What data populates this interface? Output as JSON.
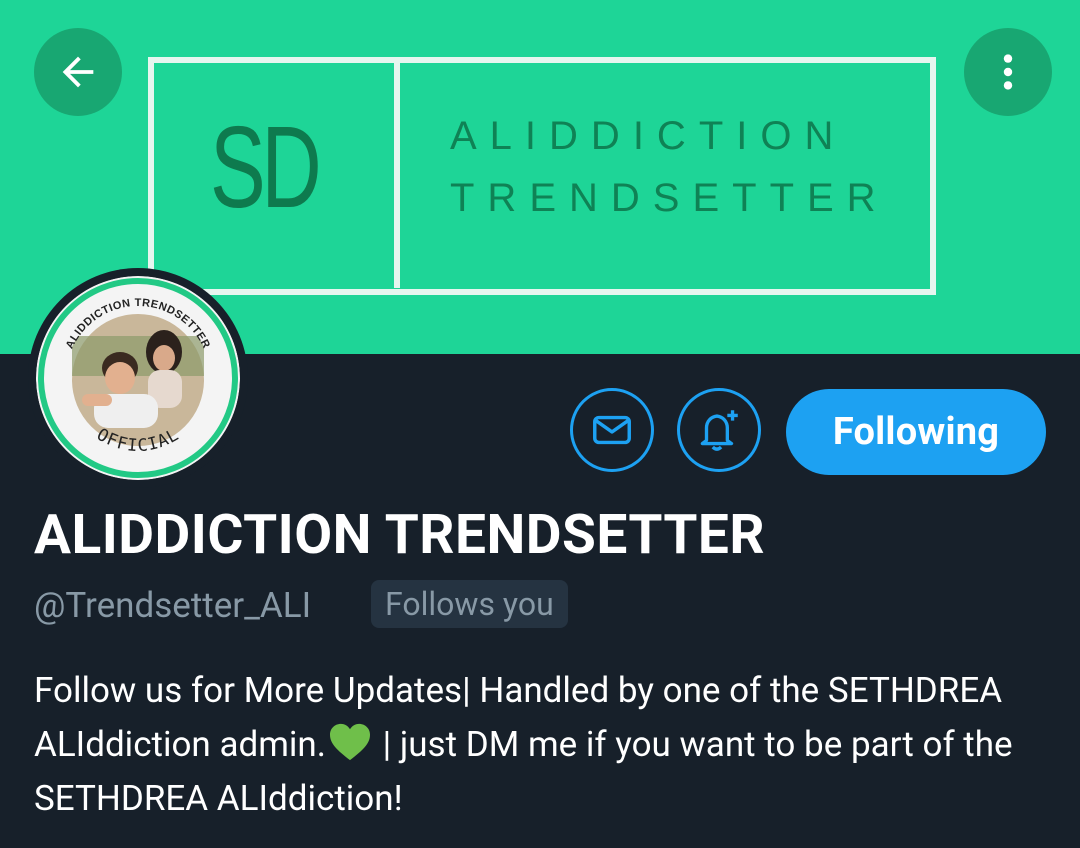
{
  "banner": {
    "logo_initials": "SD",
    "title_line1": "ALIDDICTION",
    "title_line2": "TRENDSETTER",
    "background_color": "#1ed597"
  },
  "header": {
    "back_icon": "arrow-left-icon",
    "more_icon": "more-vertical-icon"
  },
  "avatar": {
    "ring_text": "ALIDDICTION TRENDSETTER",
    "badge_text": "OFFICIAL"
  },
  "actions": {
    "message_icon": "mail-icon",
    "notify_icon": "bell-plus-icon",
    "following_label": "Following",
    "accent_color": "#1da1f2"
  },
  "profile": {
    "display_name": "ALIDDICTION TRENDSETTER",
    "handle": "@Trendsetter_ALI",
    "follows_you": "Follows you",
    "bio_part1": "Follow us for More Updates| Handled by one of the SETHDREA ALIddiction admin.",
    "bio_emoji": "green-heart",
    "bio_part2": " | just DM me if you want to be part of the SETHDREA ALIddiction!"
  }
}
